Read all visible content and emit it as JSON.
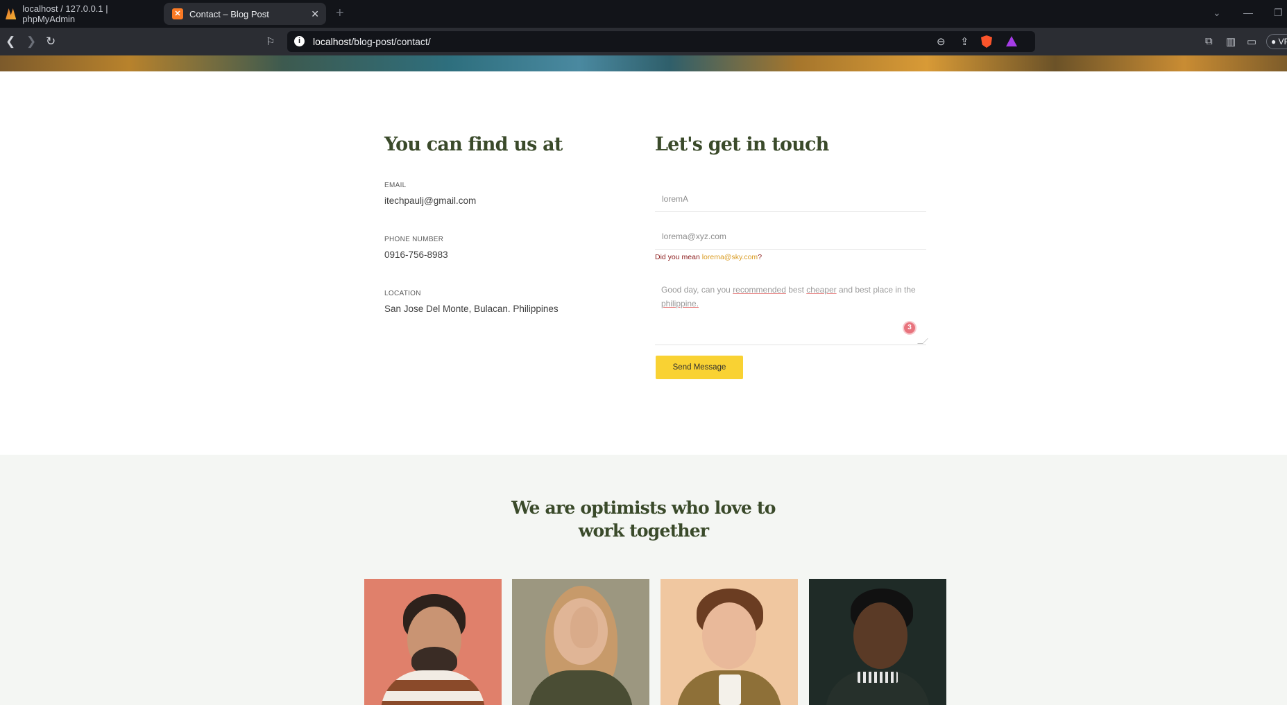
{
  "browser": {
    "tabs": [
      {
        "title": "localhost / 127.0.0.1 | phpMyAdmin",
        "active": false,
        "favicon": "phpmyadmin-icon"
      },
      {
        "title": "Contact – Blog Post",
        "active": true,
        "favicon": "xampp-icon"
      }
    ],
    "url_host": "localhost",
    "url_path": "/blog-post/contact/",
    "vpn_label": "VP"
  },
  "contact_info": {
    "title": "You can find us at",
    "email_label": "EMAIL",
    "email": "itechpaulj@gmail.com",
    "phone_label": "PHONE NUMBER",
    "phone": "0916-756-8983",
    "location_label": "LOCATION",
    "location": "San Jose Del Monte, Bulacan. Philippines"
  },
  "form": {
    "title": "Let's get in touch",
    "name_value": "loremA",
    "email_value": "lorema@xyz.com",
    "suggestion_prefix": "Did you mean ",
    "suggestion_email": "lorema@sky.com",
    "suggestion_suffix": "?",
    "message_parts": [
      "Good day, can you ",
      "recommended",
      " best ",
      "cheaper",
      " and best place in the ",
      "philippine."
    ],
    "grammar_badge_count": "3",
    "submit_label": "Send Message"
  },
  "team": {
    "title_line1": "We are optimists who love to",
    "title_line2": "work together"
  },
  "colors": {
    "heading": "#3a4a2a",
    "button": "#f9d233",
    "section_bg": "#f4f6f3",
    "suggestion_link": "#d99a1f"
  }
}
